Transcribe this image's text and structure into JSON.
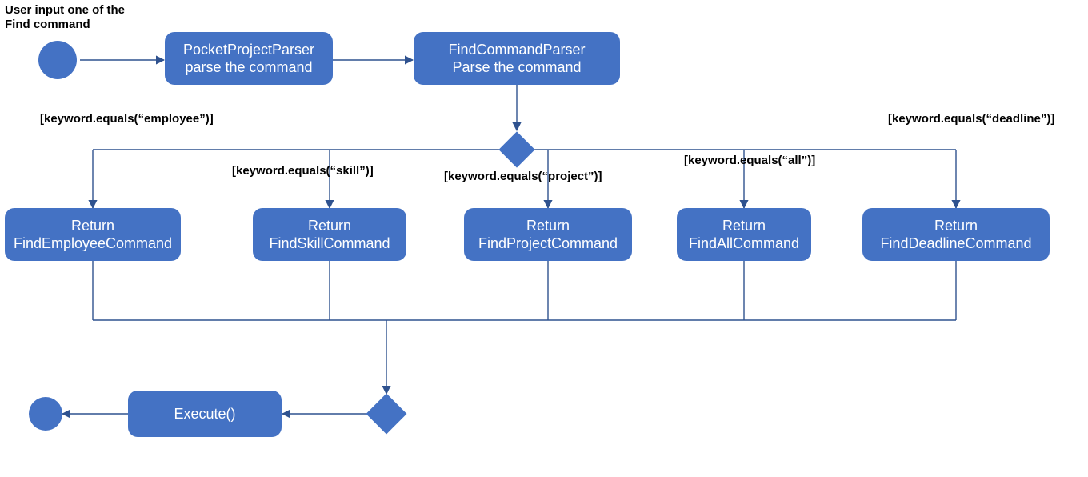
{
  "chart_data": {
    "type": "activity-diagram",
    "title": "User input one of the Find command",
    "nodes": [
      {
        "id": "start",
        "kind": "initial"
      },
      {
        "id": "ppp",
        "kind": "action",
        "text_lines": [
          "PocketProjectParser",
          "parse the command"
        ]
      },
      {
        "id": "fcp",
        "kind": "action",
        "text_lines": [
          "FindCommandParser",
          "Parse the command"
        ]
      },
      {
        "id": "dec1",
        "kind": "decision"
      },
      {
        "id": "r_emp",
        "kind": "action",
        "text_lines": [
          "Return",
          "FindEmployeeCommand"
        ]
      },
      {
        "id": "r_skill",
        "kind": "action",
        "text_lines": [
          "Return",
          "FindSkillCommand"
        ]
      },
      {
        "id": "r_proj",
        "kind": "action",
        "text_lines": [
          "Return",
          "FindProjectCommand"
        ]
      },
      {
        "id": "r_all",
        "kind": "action",
        "text_lines": [
          "Return",
          "FindAllCommand"
        ]
      },
      {
        "id": "r_dead",
        "kind": "action",
        "text_lines": [
          "Return",
          "FindDeadlineCommand"
        ]
      },
      {
        "id": "merge",
        "kind": "merge"
      },
      {
        "id": "exec",
        "kind": "action",
        "text_lines": [
          "Execute()"
        ]
      },
      {
        "id": "end",
        "kind": "final"
      }
    ],
    "edges": [
      {
        "from": "start",
        "to": "ppp"
      },
      {
        "from": "ppp",
        "to": "fcp"
      },
      {
        "from": "fcp",
        "to": "dec1"
      },
      {
        "from": "dec1",
        "to": "r_emp",
        "guard": "[keyword.equals(“employee”)]"
      },
      {
        "from": "dec1",
        "to": "r_skill",
        "guard": "[keyword.equals(“skill”)]"
      },
      {
        "from": "dec1",
        "to": "r_proj",
        "guard": "[keyword.equals(“project”)]"
      },
      {
        "from": "dec1",
        "to": "r_all",
        "guard": "[keyword.equals(“all”)]"
      },
      {
        "from": "dec1",
        "to": "r_dead",
        "guard": "[keyword.equals(“deadline”)]"
      },
      {
        "from": "r_emp",
        "to": "merge"
      },
      {
        "from": "r_skill",
        "to": "merge"
      },
      {
        "from": "r_proj",
        "to": "merge"
      },
      {
        "from": "r_all",
        "to": "merge"
      },
      {
        "from": "r_dead",
        "to": "merge"
      },
      {
        "from": "merge",
        "to": "exec"
      },
      {
        "from": "exec",
        "to": "end"
      }
    ],
    "colors": {
      "fill": "#4472c4",
      "stroke": "#2f528f"
    }
  },
  "title_lines": [
    "User input one of the",
    "Find command"
  ],
  "nodes": {
    "ppp": {
      "l1": "PocketProjectParser",
      "l2": "parse the command"
    },
    "fcp": {
      "l1": "FindCommandParser",
      "l2": "Parse the command"
    },
    "r_emp": {
      "l1": "Return",
      "l2": "FindEmployeeCommand"
    },
    "r_skill": {
      "l1": "Return",
      "l2": "FindSkillCommand"
    },
    "r_proj": {
      "l1": "Return",
      "l2": "FindProjectCommand"
    },
    "r_all": {
      "l1": "Return",
      "l2": "FindAllCommand"
    },
    "r_dead": {
      "l1": "Return",
      "l2": "FindDeadlineCommand"
    },
    "exec": {
      "l1": "Execute()"
    }
  },
  "guards": {
    "emp": "[keyword.equals(“employee”)]",
    "skill": "[keyword.equals(“skill”)]",
    "proj": "[keyword.equals(“project”)]",
    "all": "[keyword.equals(“all”)]",
    "dead": "[keyword.equals(“deadline”)]"
  }
}
